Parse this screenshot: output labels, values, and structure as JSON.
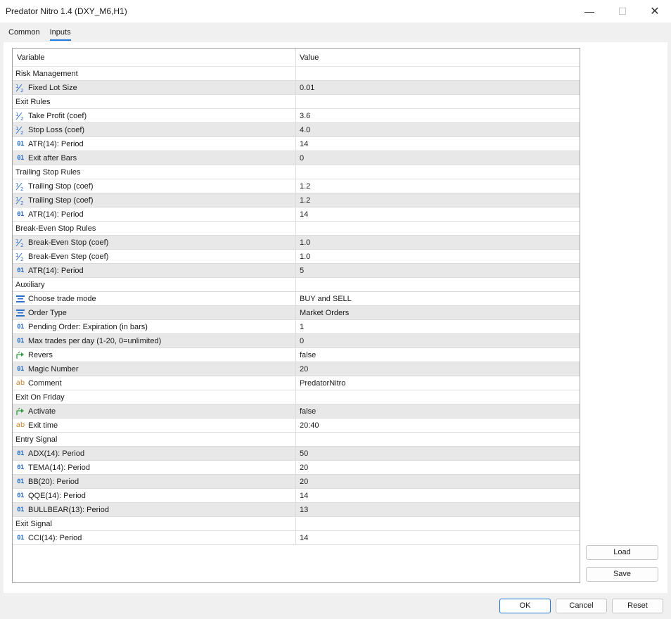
{
  "window": {
    "title": "Predator Nitro 1.4 (DXY_M6,H1)",
    "minimize": "—",
    "maximize": "☐",
    "close": "✕"
  },
  "tabs": [
    {
      "label": "Common",
      "active": false
    },
    {
      "label": "Inputs",
      "active": true
    }
  ],
  "grid": {
    "columns": {
      "variable": "Variable",
      "value": "Value"
    },
    "rows": [
      {
        "type": "group",
        "name": "Risk Management",
        "value": "",
        "icon": "none"
      },
      {
        "type": "param",
        "name": "Fixed Lot Size",
        "value": "0.01",
        "icon": "double-icon"
      },
      {
        "type": "group",
        "name": "Exit Rules",
        "value": "",
        "icon": "none"
      },
      {
        "type": "param",
        "name": "Take Profit (coef)",
        "value": "3.6",
        "icon": "double-icon"
      },
      {
        "type": "param",
        "name": "Stop Loss (coef)",
        "value": "4.0",
        "icon": "double-icon"
      },
      {
        "type": "param",
        "name": "ATR(14): Period",
        "value": "14",
        "icon": "integer-icon"
      },
      {
        "type": "param",
        "name": "Exit after Bars",
        "value": "0",
        "icon": "integer-icon"
      },
      {
        "type": "group",
        "name": "Trailing Stop Rules",
        "value": "",
        "icon": "none"
      },
      {
        "type": "param",
        "name": "Trailing Stop (coef)",
        "value": "1.2",
        "icon": "double-icon"
      },
      {
        "type": "param",
        "name": "Trailing Step (coef)",
        "value": "1.2",
        "icon": "double-icon"
      },
      {
        "type": "param",
        "name": "ATR(14): Period",
        "value": "14",
        "icon": "integer-icon"
      },
      {
        "type": "group",
        "name": "Break-Even Stop Rules",
        "value": "",
        "icon": "none"
      },
      {
        "type": "param",
        "name": "Break-Even Stop (coef)",
        "value": "1.0",
        "icon": "double-icon"
      },
      {
        "type": "param",
        "name": "Break-Even Step (coef)",
        "value": "1.0",
        "icon": "double-icon"
      },
      {
        "type": "param",
        "name": "ATR(14): Period",
        "value": "5",
        "icon": "integer-icon"
      },
      {
        "type": "group",
        "name": "Auxiliary",
        "value": "",
        "icon": "none"
      },
      {
        "type": "param",
        "name": "Choose trade mode",
        "value": "BUY and SELL",
        "icon": "enum-icon"
      },
      {
        "type": "param",
        "name": "Order Type",
        "value": "Market Orders",
        "icon": "enum-icon"
      },
      {
        "type": "param",
        "name": "Pending Order: Expiration (in bars)",
        "value": "1",
        "icon": "integer-icon"
      },
      {
        "type": "param",
        "name": "Max trades per day (1-20, 0=unlimited)",
        "value": "0",
        "icon": "integer-icon"
      },
      {
        "type": "param",
        "name": "Revers",
        "value": "false",
        "icon": "bool-icon"
      },
      {
        "type": "param",
        "name": "Magic Number",
        "value": "20",
        "icon": "integer-icon"
      },
      {
        "type": "param",
        "name": "Comment",
        "value": "PredatorNitro",
        "icon": "string-icon"
      },
      {
        "type": "group",
        "name": "Exit On Friday",
        "value": "",
        "icon": "none"
      },
      {
        "type": "param",
        "name": "Activate",
        "value": "false",
        "icon": "bool-icon"
      },
      {
        "type": "param",
        "name": "Exit time",
        "value": "20:40",
        "icon": "string-icon"
      },
      {
        "type": "group",
        "name": "Entry Signal",
        "value": "",
        "icon": "none"
      },
      {
        "type": "param",
        "name": "ADX(14):  Period",
        "value": "50",
        "icon": "integer-icon"
      },
      {
        "type": "param",
        "name": "TEMA(14): Period",
        "value": "20",
        "icon": "integer-icon"
      },
      {
        "type": "param",
        "name": "BB(20):   Period",
        "value": "20",
        "icon": "integer-icon"
      },
      {
        "type": "param",
        "name": "QQE(14):  Period",
        "value": "14",
        "icon": "integer-icon"
      },
      {
        "type": "param",
        "name": "BULLBEAR(13): Period",
        "value": "13",
        "icon": "integer-icon"
      },
      {
        "type": "group",
        "name": "Exit Signal",
        "value": "",
        "icon": "none"
      },
      {
        "type": "param",
        "name": "CCI(14):  Period",
        "value": "14",
        "icon": "integer-icon"
      }
    ]
  },
  "side_buttons": {
    "load": "Load",
    "save": "Save"
  },
  "footer": {
    "ok": "OK",
    "cancel": "Cancel",
    "reset": "Reset"
  },
  "glyphs": {
    "integer": "01",
    "string": "ab"
  },
  "colors": {
    "accent": "#1e78d7",
    "integer_icon": "#2a6fc9",
    "string_icon": "#c8822a",
    "bool_icon": "#2e9e3e",
    "alt_row": "#e8e8e8"
  }
}
